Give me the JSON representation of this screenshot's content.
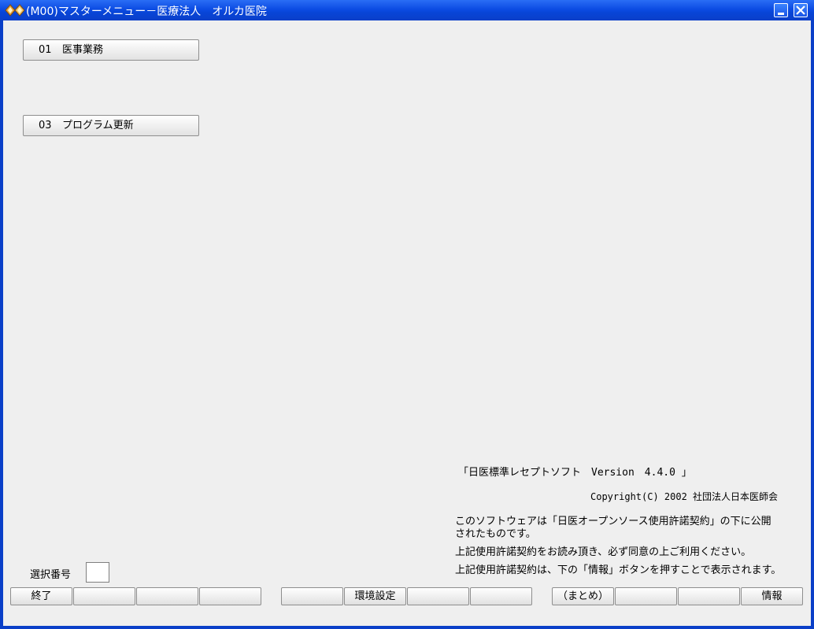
{
  "window": {
    "title": "(M00)マスターメニュー－医療法人　オルカ医院"
  },
  "menu": [
    {
      "num": "01",
      "label": "医事業務"
    },
    {
      "num": "03",
      "label": "プログラム更新"
    }
  ],
  "info": {
    "version": "「日医標準レセプトソフト　Version　4.4.0 」",
    "copyright": "Copyright(C) 2002 社団法人日本医師会",
    "license_line1": "このソフトウェアは「日医オープンソース使用許諾契約」の下に公開",
    "license_line2": "されたものです。",
    "license_line3": "上記使用許諾契約をお読み頂き、必ず同意の上ご利用ください。",
    "license_line4": "上記使用許諾契約は、下の「情報」ボタンを押すことで表示されます。"
  },
  "selection": {
    "label": "選択番号",
    "value": ""
  },
  "function_keys": [
    "終了",
    "",
    "",
    "",
    "",
    "環境設定",
    "",
    "",
    "（まとめ）",
    "",
    "",
    "情報"
  ],
  "colors": {
    "titlebar": "#0a3fc8",
    "client_bg": "#efefef"
  }
}
